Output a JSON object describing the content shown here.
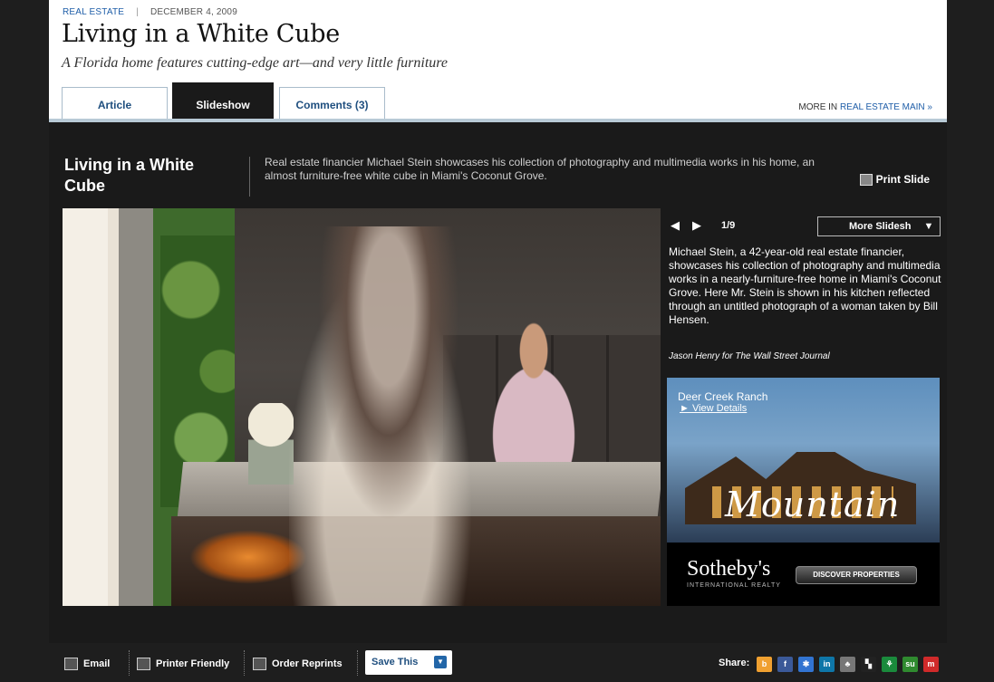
{
  "article": {
    "category": "REAL ESTATE",
    "date": "DECEMBER 4, 2009",
    "title": "Living in a White Cube",
    "dek": "A Florida home features cutting-edge art—and very little furniture"
  },
  "tabs": [
    {
      "label": "Article"
    },
    {
      "label": "Slideshow"
    },
    {
      "label": "Comments (3)"
    }
  ],
  "more_in": {
    "prefix": "MORE IN ",
    "link": "REAL ESTATE MAIN »"
  },
  "slideshow": {
    "title": "Living in a White Cube",
    "description": "Real estate financier Michael Stein showcases his collection of photography and multimedia works in his home, an almost furniture-free white cube in Miami's Coconut Grove.",
    "print_label": "Print Slide",
    "prev_arrow": "◀",
    "next_arrow": "▶",
    "counter": "1/9",
    "more_label": "More Slidesh",
    "caption": "Michael Stein, a 42-year-old real estate financier, showcases his collection of photography and multimedia works in a nearly-furniture-free home in Miami's Coconut Grove. Here Mr. Stein is shown in his kitchen reflected through an untitled photograph of a woman taken by Bill Hensen.",
    "credit": "Jason Henry for The Wall Street Journal"
  },
  "ad": {
    "ranch": "Deer Creek Ranch",
    "view_details": "► View Details",
    "headline": "Mountain",
    "brand": "Sotheby's",
    "brand_sub": "INTERNATIONAL REALTY",
    "cta": "DISCOVER PROPERTIES"
  },
  "toolbar": {
    "email": "Email",
    "printer_friendly": "Printer Friendly",
    "order_reprints": "Order Reprints",
    "save_this": "Save This",
    "share": "Share:"
  },
  "share_icons": [
    {
      "name": "buzz-icon",
      "glyph": "b",
      "color": "#f0a030"
    },
    {
      "name": "facebook-icon",
      "glyph": "f",
      "color": "#3b5998"
    },
    {
      "name": "delicious-icon",
      "glyph": "✱",
      "color": "#3274d1"
    },
    {
      "name": "linkedin-icon",
      "glyph": "in",
      "color": "#0e76a8"
    },
    {
      "name": "myspace-icon",
      "glyph": "♣",
      "color": "#777777"
    },
    {
      "name": "delicious2-icon",
      "glyph": "▚",
      "color": "#222222"
    },
    {
      "name": "yahoo-buzz-icon",
      "glyph": "⚘",
      "color": "#1a8a3c"
    },
    {
      "name": "stumbleupon-icon",
      "glyph": "su",
      "color": "#2f8a2f"
    },
    {
      "name": "mixx-icon",
      "glyph": "m",
      "color": "#d02a2a"
    }
  ]
}
